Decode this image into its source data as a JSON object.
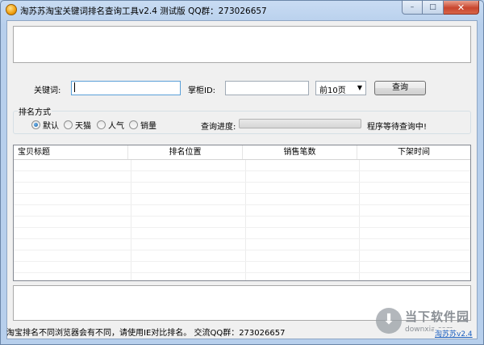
{
  "window": {
    "title": "淘苏苏淘宝关键词排名查询工具v2.4 测试版 QQ群：273026657",
    "controls": {
      "minimize": "–",
      "maximize": "□",
      "close": "✕"
    }
  },
  "search": {
    "keyword_label": "关键词:",
    "keyword_value": "",
    "shop_label": "掌柜ID:",
    "shop_value": "",
    "pages_selected": "前10页",
    "query_button": "查询"
  },
  "ranking": {
    "group_label": "排名方式",
    "options": [
      "默认",
      "天猫",
      "人气",
      "销量"
    ],
    "selected": "默认",
    "progress_label": "查询进度:",
    "progress": 0,
    "status": "程序等待查询中!"
  },
  "results": {
    "columns": [
      "宝贝标题",
      "排名位置",
      "销售笔数",
      "下架时间"
    ],
    "rows": []
  },
  "footer": {
    "status_text": "淘宝排名不同浏览器会有不同，请使用IE对比排名。 交流QQ群：273026657",
    "watermark_brand": "当下软件园",
    "watermark_site": "downxia.com",
    "link_text": "淘苏苏v2.4"
  }
}
